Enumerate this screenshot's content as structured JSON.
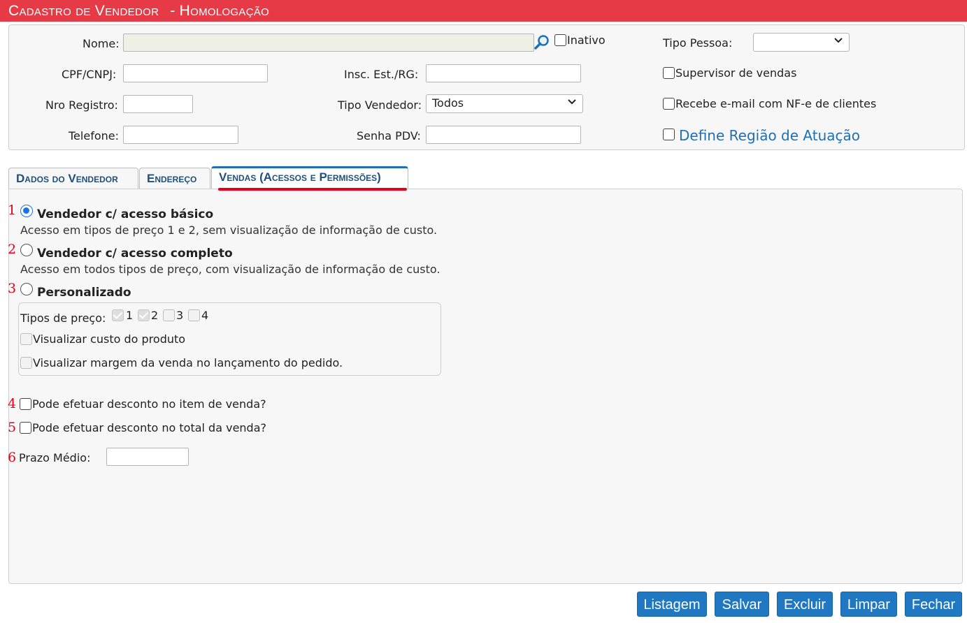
{
  "window": {
    "title": "Cadastro de Vendedor",
    "env": "- Homologação"
  },
  "header": {
    "nome_label": "Nome:",
    "nome_value": "",
    "inativo_label": "Inativo",
    "tipo_pessoa_label": "Tipo Pessoa:",
    "tipo_pessoa_value": "",
    "cpf_label": "CPF/CNPJ:",
    "cpf_value": "",
    "insc_label": "Insc. Est./RG:",
    "insc_value": "",
    "supervisor_label": "Supervisor de vendas",
    "nro_label": "Nro Registro:",
    "nro_value": "",
    "tipo_vendedor_label": "Tipo Vendedor:",
    "tipo_vendedor_value": "Todos",
    "recebe_email_label": "Recebe e-mail com NF-e de clientes",
    "telefone_label": "Telefone:",
    "telefone_value": "",
    "senha_label": "Senha PDV:",
    "senha_value": "",
    "regiao_label": "Define Região de Atuação"
  },
  "tabs": [
    {
      "label": "Dados do Vendedor",
      "active": false
    },
    {
      "label": "Endereço",
      "active": false
    },
    {
      "label": "Vendas (Acessos e Permissões)",
      "active": true
    }
  ],
  "vendas": {
    "markers": [
      "1",
      "2",
      "3",
      "4",
      "5",
      "6"
    ],
    "opt_basico_title": "Vendedor c/ acesso básico",
    "opt_basico_desc": "Acesso em tipos de preço 1 e 2, sem visualização de informação de custo.",
    "opt_completo_title": "Vendedor c/ acesso completo",
    "opt_completo_desc": "Acesso em todos tipos de preço, com visualização de informação de custo.",
    "opt_personalizado_title": "Personalizado",
    "selected_option": "basico",
    "tipos_preco_label": "Tipos de preço:",
    "tipos_preco": [
      {
        "label": "1",
        "checked": true
      },
      {
        "label": "2",
        "checked": true
      },
      {
        "label": "3",
        "checked": false
      },
      {
        "label": "4",
        "checked": false
      }
    ],
    "visualizar_custo_label": "Visualizar custo do produto",
    "visualizar_margem_label": "Visualizar margem da venda no lançamento do pedido.",
    "desconto_item_label": "Pode efetuar desconto no item de venda?",
    "desconto_total_label": "Pode efetuar desconto no total da venda?",
    "prazo_medio_label": "Prazo Médio:",
    "prazo_medio_value": ""
  },
  "buttons": {
    "listagem": "Listagem",
    "salvar": "Salvar",
    "excluir": "Excluir",
    "limpar": "Limpar",
    "fechar": "Fechar"
  },
  "colors": {
    "title_bar": "#e63b46",
    "accent": "#1f78c1",
    "marker_red": "#e6001a"
  },
  "icons": {
    "search": "search-icon",
    "dropdown": "chevron-down-icon"
  }
}
